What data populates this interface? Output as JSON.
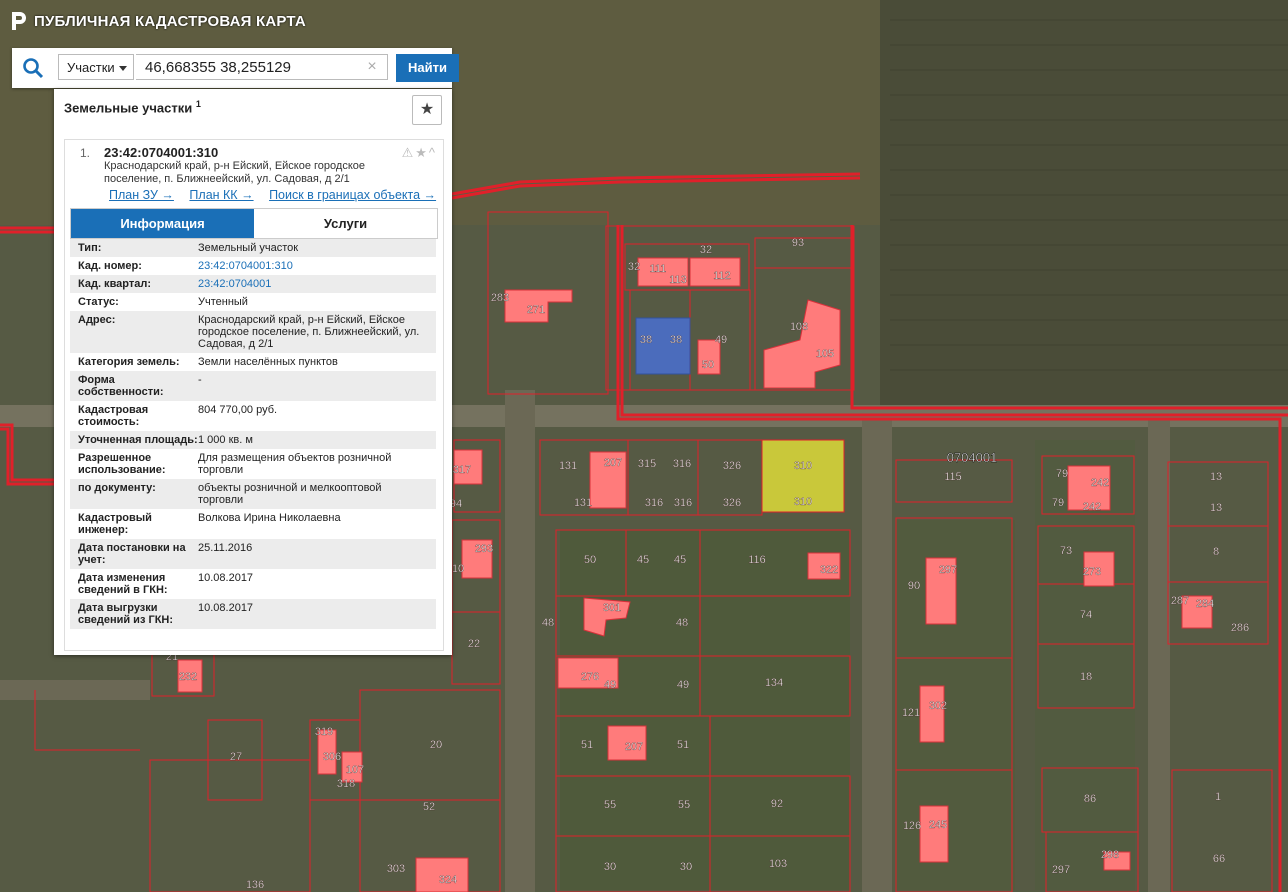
{
  "app": {
    "title": "ПУБЛИЧНАЯ КАДАСТРОВАЯ КАРТА"
  },
  "search": {
    "type_label": "Участки",
    "query": "46,668355 38,255129",
    "clear_symbol": "×",
    "button_label": "Найти"
  },
  "panel": {
    "title": "Земельные участки",
    "count": "1",
    "favorite_symbol": "★"
  },
  "result": {
    "index": "1.",
    "cadastral_number": "23:42:0704001:310",
    "address": "Краснодарский край, р-н Ейский, Ейское городское поселение, п. Ближнеейский, ул. Садовая, д 2/1",
    "status_icons": "⚠★^",
    "links": [
      "План ЗУ →",
      "План КК →",
      "Поиск в границах объекта →"
    ]
  },
  "tabs": [
    "Информация",
    "Услуги"
  ],
  "info": [
    {
      "label": "Тип:",
      "value": "Земельный участок"
    },
    {
      "label": "Кад. номер:",
      "value": "23:42:0704001:310",
      "link": true
    },
    {
      "label": "Кад. квартал:",
      "value": "23:42:0704001",
      "link": true
    },
    {
      "label": "Статус:",
      "value": "Учтенный"
    },
    {
      "label": "Адрес:",
      "value": "Краснодарский край, р-н Ейский, Ейское городское поселение, п. Ближнеейский, ул. Садовая, д 2/1"
    },
    {
      "label": "Категория земель:",
      "value": "Земли населённых пунктов"
    },
    {
      "label": "Форма собственности:",
      "value": "-"
    },
    {
      "label": "Кадастровая стоимость:",
      "value": "804 770,00 руб."
    },
    {
      "label": "Уточненная площадь:",
      "value": "1 000 кв. м"
    },
    {
      "label": "Разрешенное использование:",
      "value": "Для размещения объектов розничной торговли"
    },
    {
      "label": "по документу:",
      "value": "объекты розничной и мелкооптовой торговли"
    },
    {
      "label": "Кадастровый инженер:",
      "value": "Волкова Ирина Николаевна"
    },
    {
      "label": "Дата постановки на учет:",
      "value": "25.11.2016"
    },
    {
      "label": "Дата изменения сведений в ГКН:",
      "value": "10.08.2017"
    },
    {
      "label": "Дата выгрузки сведений из ГКН:",
      "value": "10.08.2017"
    }
  ],
  "map": {
    "quarter_label": "0704001",
    "colors": {
      "boundary": "#e0202a",
      "building": "#ff7b7b",
      "selected": "#c9c83a"
    },
    "labels": [
      "93",
      "32",
      "32",
      "111",
      "113",
      "112",
      "283",
      "271",
      "38",
      "38",
      "49",
      "50",
      "108",
      "105",
      "131",
      "207",
      "315",
      "316",
      "326",
      "310",
      "131",
      "316",
      "316",
      "326",
      "310",
      "317",
      "94",
      "115",
      "79",
      "79",
      "242",
      "242",
      "13",
      "13",
      "293",
      "10",
      "50",
      "45",
      "45",
      "116",
      "322",
      "73",
      "273",
      "8",
      "48",
      "301",
      "48",
      "90",
      "297",
      "74",
      "287",
      "284",
      "286",
      "21",
      "232",
      "22",
      "276",
      "49",
      "49",
      "134",
      "18",
      "121",
      "302",
      "20",
      "27",
      "319",
      "306",
      "107",
      "318",
      "51",
      "207",
      "51",
      "52",
      "55",
      "55",
      "92",
      "126",
      "245",
      "86",
      "1",
      "303",
      "324",
      "30",
      "30",
      "103",
      "136",
      "297",
      "298",
      "66"
    ]
  }
}
